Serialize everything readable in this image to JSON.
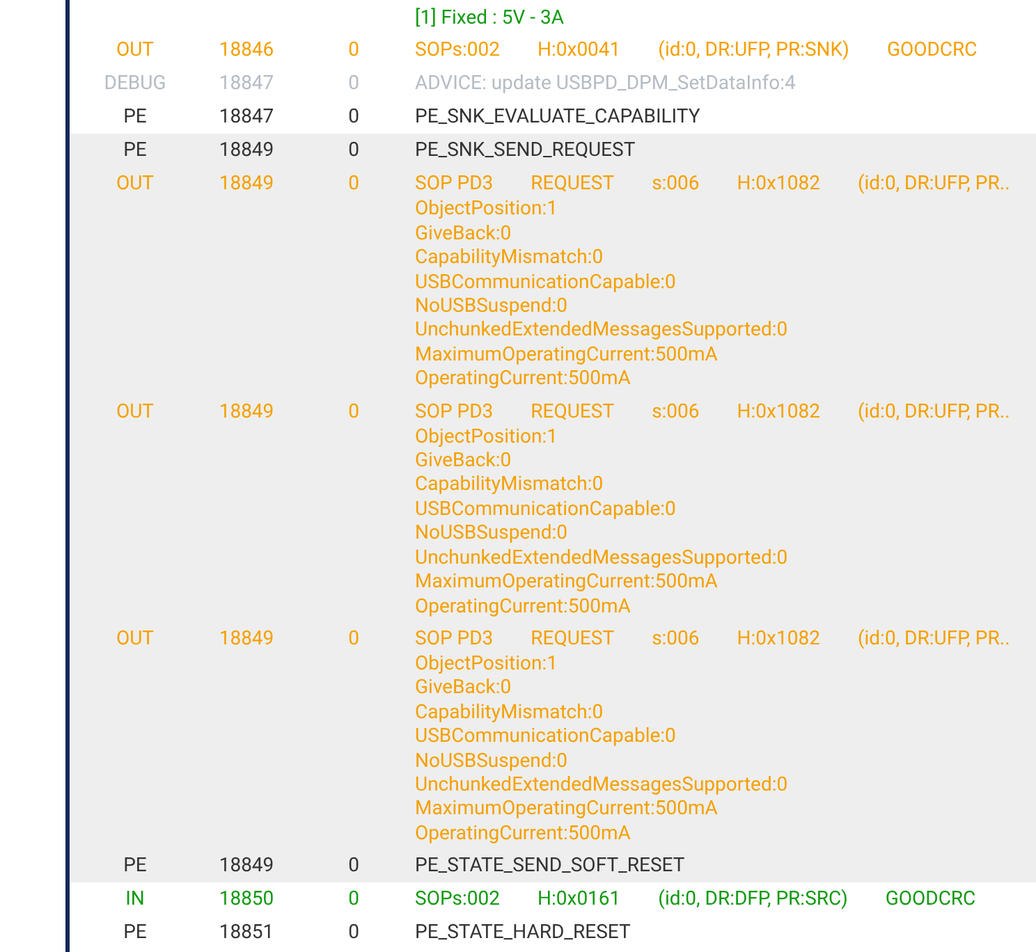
{
  "log": {
    "rows": [
      {
        "kind": "in",
        "selected": false,
        "type": "",
        "number": "",
        "count": "",
        "fields": [],
        "details": [
          "[1] Fixed : 5V - 3A"
        ]
      },
      {
        "kind": "out",
        "selected": false,
        "type": "OUT",
        "number": "18846",
        "count": "0",
        "fields": [
          "SOPs:002",
          "H:0x0041",
          "(id:0, DR:UFP, PR:SNK)",
          "GOODCRC"
        ],
        "details": []
      },
      {
        "kind": "debug",
        "selected": false,
        "type": "DEBUG",
        "number": "18847",
        "count": "0",
        "fields": [
          "ADVICE: update USBPD_DPM_SetDataInfo:4"
        ],
        "details": []
      },
      {
        "kind": "pe",
        "selected": false,
        "type": "PE",
        "number": "18847",
        "count": "0",
        "fields": [
          "PE_SNK_EVALUATE_CAPABILITY"
        ],
        "details": []
      },
      {
        "kind": "pe",
        "selected": true,
        "type": "PE",
        "number": "18849",
        "count": "0",
        "fields": [
          "PE_SNK_SEND_REQUEST"
        ],
        "details": []
      },
      {
        "kind": "out",
        "selected": true,
        "type": "OUT",
        "number": "18849",
        "count": "0",
        "fields": [
          "SOP PD3",
          "REQUEST",
          "s:006",
          "H:0x1082",
          "(id:0, DR:UFP, PR.."
        ],
        "details": [
          "ObjectPosition:1",
          "GiveBack:0",
          "CapabilityMismatch:0",
          "USBCommunicationCapable:0",
          "NoUSBSuspend:0",
          "UnchunkedExtendedMessagesSupported:0",
          "MaximumOperatingCurrent:500mA",
          "OperatingCurrent:500mA"
        ]
      },
      {
        "kind": "out",
        "selected": true,
        "type": "OUT",
        "number": "18849",
        "count": "0",
        "fields": [
          "SOP PD3",
          "REQUEST",
          "s:006",
          "H:0x1082",
          "(id:0, DR:UFP, PR.."
        ],
        "details": [
          "ObjectPosition:1",
          "GiveBack:0",
          "CapabilityMismatch:0",
          "USBCommunicationCapable:0",
          "NoUSBSuspend:0",
          "UnchunkedExtendedMessagesSupported:0",
          "MaximumOperatingCurrent:500mA",
          "OperatingCurrent:500mA"
        ]
      },
      {
        "kind": "out",
        "selected": true,
        "type": "OUT",
        "number": "18849",
        "count": "0",
        "fields": [
          "SOP PD3",
          "REQUEST",
          "s:006",
          "H:0x1082",
          "(id:0, DR:UFP, PR.."
        ],
        "details": [
          "ObjectPosition:1",
          "GiveBack:0",
          "CapabilityMismatch:0",
          "USBCommunicationCapable:0",
          "NoUSBSuspend:0",
          "UnchunkedExtendedMessagesSupported:0",
          "MaximumOperatingCurrent:500mA",
          "OperatingCurrent:500mA"
        ]
      },
      {
        "kind": "pe",
        "selected": true,
        "type": "PE",
        "number": "18849",
        "count": "0",
        "fields": [
          "PE_STATE_SEND_SOFT_RESET"
        ],
        "details": []
      },
      {
        "kind": "in",
        "selected": false,
        "type": "IN",
        "number": "18850",
        "count": "0",
        "fields": [
          "SOPs:002",
          "H:0x0161",
          "(id:0, DR:DFP, PR:SRC)",
          "GOODCRC"
        ],
        "details": []
      },
      {
        "kind": "pe",
        "selected": false,
        "type": "PE",
        "number": "18851",
        "count": "0",
        "fields": [
          "PE_STATE_HARD_RESET"
        ],
        "details": []
      }
    ]
  }
}
